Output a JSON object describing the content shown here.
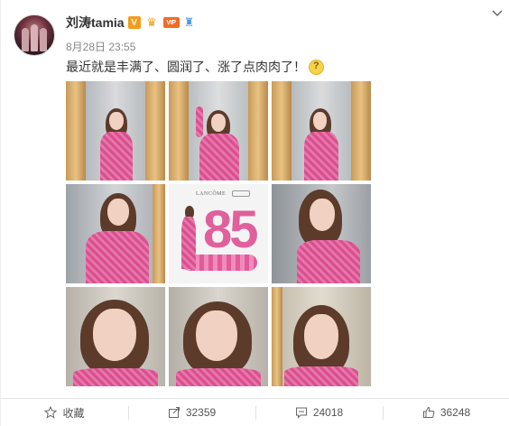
{
  "post": {
    "username": "刘涛tamia",
    "badges": [
      "V",
      "crown",
      "VIP",
      "fan"
    ],
    "vip_label": "VIP",
    "verified_label": "V",
    "timestamp": "8月28日 23:55",
    "text": "最近就是丰满了、圆润了、涨了点肉肉了！",
    "emoji": "doubt-face-emoji",
    "photos": [
      {
        "scene": "pink-dress-curtain-front"
      },
      {
        "scene": "pink-dress-curtain-hand-up"
      },
      {
        "scene": "pink-dress-curtain-side"
      },
      {
        "scene": "pink-dress-closeup-smile"
      },
      {
        "scene": "lancome-85-flower-display"
      },
      {
        "scene": "pink-dress-profile"
      },
      {
        "scene": "portrait-curtain-1"
      },
      {
        "scene": "portrait-curtain-2"
      },
      {
        "scene": "portrait-curtain-3"
      }
    ],
    "lancome_number": "85",
    "lancome_brand": "LANCÔME"
  },
  "actions": {
    "favorite_label": "收藏",
    "share_count": "32359",
    "comment_count": "24018",
    "like_count": "36248"
  },
  "colors": {
    "accent_pink": "#d9508f",
    "verified_orange": "#f79a1a",
    "text": "#333333",
    "meta": "#888888"
  }
}
